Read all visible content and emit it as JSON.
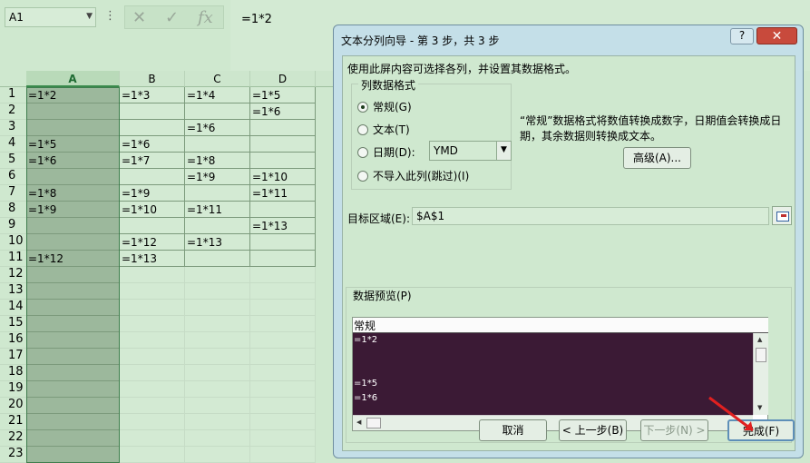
{
  "formula_bar": {
    "name_box": "A1",
    "separator": "⋮",
    "formula": "=1*2"
  },
  "columns": [
    "A",
    "B",
    "C",
    "D"
  ],
  "rows": [
    {
      "n": "1",
      "cells": [
        "=1*2",
        "=1*3",
        "=1*4",
        "=1*5"
      ]
    },
    {
      "n": "2",
      "cells": [
        "",
        "",
        "",
        "=1*6"
      ]
    },
    {
      "n": "3",
      "cells": [
        "",
        "",
        "=1*6",
        ""
      ]
    },
    {
      "n": "4",
      "cells": [
        "=1*5",
        "=1*6",
        "",
        ""
      ]
    },
    {
      "n": "5",
      "cells": [
        "=1*6",
        "=1*7",
        "=1*8",
        ""
      ]
    },
    {
      "n": "6",
      "cells": [
        "",
        "",
        "=1*9",
        "=1*10"
      ]
    },
    {
      "n": "7",
      "cells": [
        "=1*8",
        "=1*9",
        "",
        "=1*11"
      ]
    },
    {
      "n": "8",
      "cells": [
        "=1*9",
        "=1*10",
        "=1*11",
        ""
      ]
    },
    {
      "n": "9",
      "cells": [
        "",
        "",
        "",
        "=1*13"
      ]
    },
    {
      "n": "10",
      "cells": [
        "",
        "=1*12",
        "=1*13",
        ""
      ]
    },
    {
      "n": "11",
      "cells": [
        "=1*12",
        "=1*13",
        "",
        ""
      ]
    },
    {
      "n": "12"
    },
    {
      "n": "13"
    },
    {
      "n": "14"
    },
    {
      "n": "15"
    },
    {
      "n": "16"
    },
    {
      "n": "17"
    },
    {
      "n": "18"
    },
    {
      "n": "19"
    },
    {
      "n": "20"
    },
    {
      "n": "21"
    },
    {
      "n": "22"
    },
    {
      "n": "23"
    }
  ],
  "dialog": {
    "title": "文本分列向导 - 第 3 步，共 3 步",
    "help": "?",
    "close": "✕",
    "description": "使用此屏内容可选择各列，并设置其数据格式。",
    "format_group_title": "列数据格式",
    "options": {
      "general": "常规(G)",
      "text": "文本(T)",
      "date": "日期(D):",
      "skip": "不导入此列(跳过)(I)"
    },
    "selected_option": "general",
    "date_format": "YMD",
    "explanation": "“常规”数据格式将数值转换成数字，日期值会转换成日期，其余数据则转换成文本。",
    "advanced_button": "高级(A)...",
    "destination_label": "目标区域(E):",
    "destination_value": "$A$1",
    "preview_title": "数据预览(P)",
    "preview_header": "常规",
    "preview_rows": [
      "=1*2",
      "",
      "",
      "=1*5",
      "=1*6"
    ],
    "buttons": {
      "cancel": "取消",
      "back": "< 上一步(B)",
      "next": "下一步(N) >",
      "finish": "完成(F)"
    }
  },
  "colors": {
    "background_green": "#cfe8cf",
    "selected_column": "#9cb89c",
    "preview_bg": "#3b1a35",
    "close_red": "#c84a3c"
  }
}
